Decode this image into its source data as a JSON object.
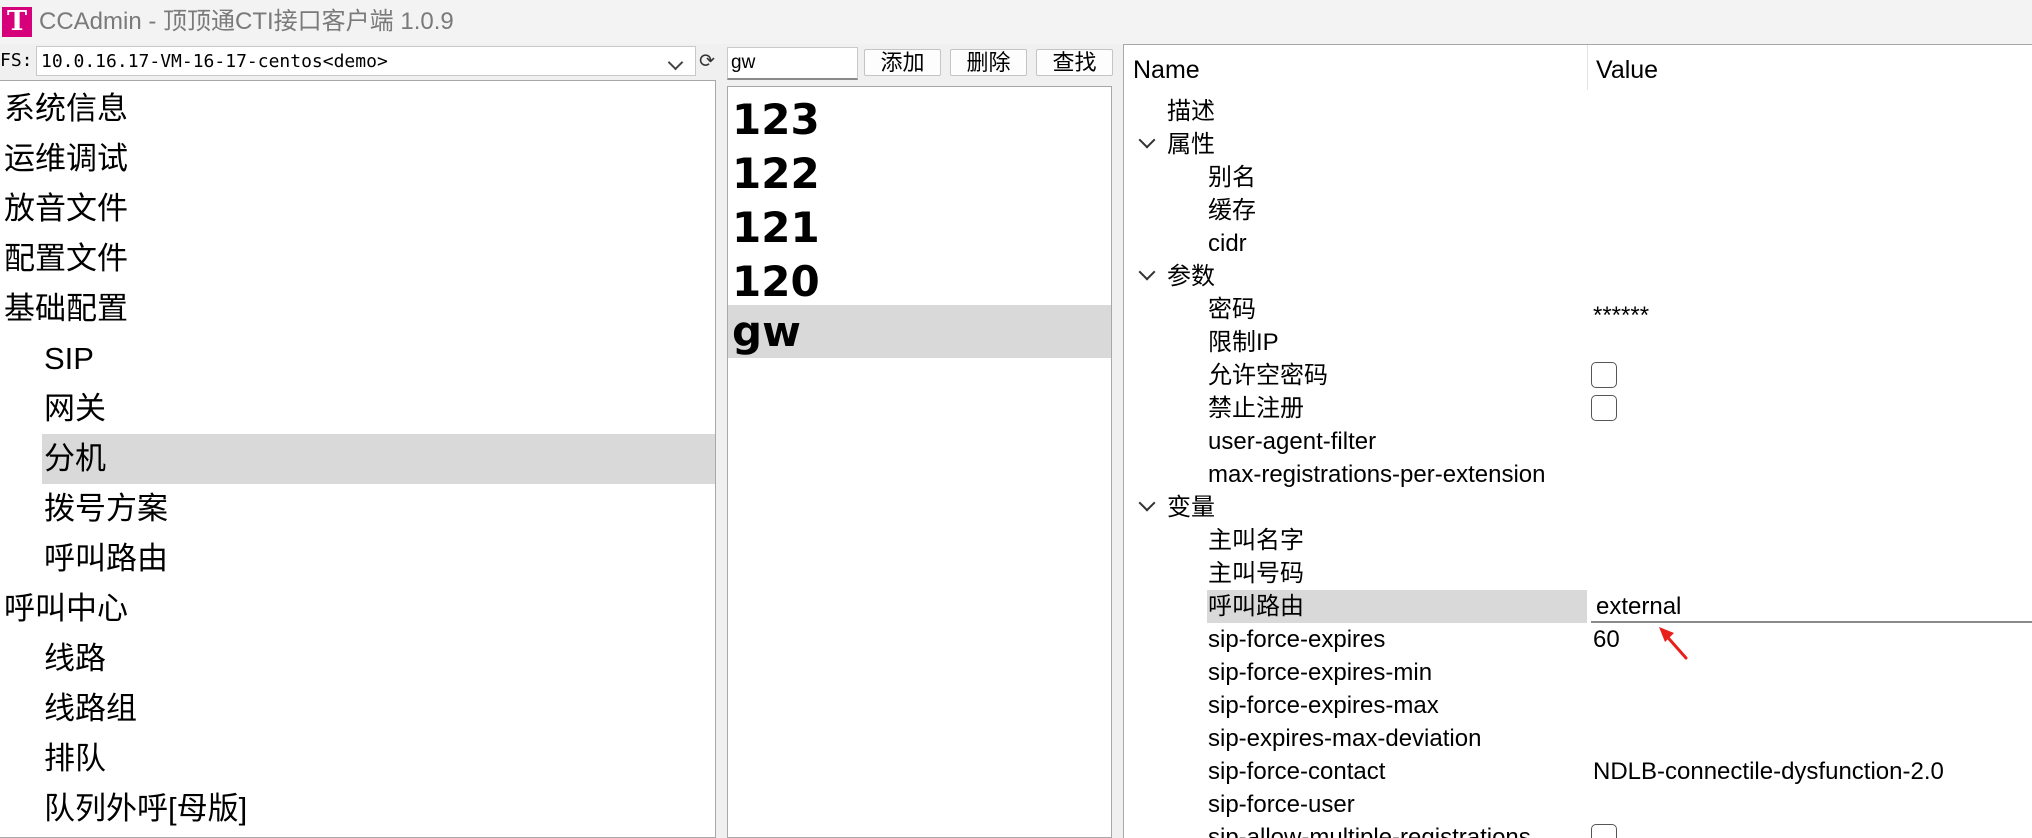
{
  "window": {
    "icon_letter": "T",
    "title": "CCAdmin - 顶顶通CTI接口客户端 1.0.9"
  },
  "fs": {
    "label": "FS:",
    "selected": "10.0.16.17-VM-16-17-centos<demo>"
  },
  "nav": {
    "items": [
      {
        "label": "系统信息"
      },
      {
        "label": "运维调试"
      },
      {
        "label": "放音文件"
      },
      {
        "label": "配置文件"
      },
      {
        "label": "基础配置"
      },
      {
        "label": "SIP"
      },
      {
        "label": "网关"
      },
      {
        "label": "分机"
      },
      {
        "label": "拨号方案"
      },
      {
        "label": "呼叫路由"
      },
      {
        "label": "呼叫中心"
      },
      {
        "label": "线路"
      },
      {
        "label": "线路组"
      },
      {
        "label": "排队"
      },
      {
        "label": "队列外呼[母版]"
      }
    ],
    "selected": "分机"
  },
  "toolbar": {
    "search_value": "gw",
    "add_label": "添加",
    "delete_label": "删除",
    "find_label": "查找"
  },
  "list": {
    "items": [
      {
        "label": "123"
      },
      {
        "label": "122"
      },
      {
        "label": "121"
      },
      {
        "label": "120"
      },
      {
        "label": "gw"
      }
    ],
    "selected": "gw"
  },
  "grid": {
    "header_name": "Name",
    "header_value": "Value",
    "rows": [
      {
        "name": "描述",
        "value": ""
      },
      {
        "name": "属性",
        "value": "",
        "group": true,
        "expanded": true
      },
      {
        "name": "别名",
        "value": ""
      },
      {
        "name": "缓存",
        "value": ""
      },
      {
        "name": "cidr",
        "value": ""
      },
      {
        "name": "参数",
        "value": "",
        "group": true,
        "expanded": true
      },
      {
        "name": "密码",
        "value": "******"
      },
      {
        "name": "限制IP",
        "value": ""
      },
      {
        "name": "允许空密码",
        "value": "",
        "checkbox": true,
        "checked": false
      },
      {
        "name": "禁止注册",
        "value": "",
        "checkbox": true,
        "checked": false
      },
      {
        "name": "user-agent-filter",
        "value": ""
      },
      {
        "name": "max-registrations-per-extension",
        "value": ""
      },
      {
        "name": "变量",
        "value": "",
        "group": true,
        "expanded": true
      },
      {
        "name": "主叫名字",
        "value": ""
      },
      {
        "name": "主叫号码",
        "value": ""
      },
      {
        "name": "呼叫路由",
        "value": "external",
        "editing": true
      },
      {
        "name": "sip-force-expires",
        "value": "60"
      },
      {
        "name": "sip-force-expires-min",
        "value": ""
      },
      {
        "name": "sip-force-expires-max",
        "value": ""
      },
      {
        "name": "sip-expires-max-deviation",
        "value": ""
      },
      {
        "name": "sip-force-contact",
        "value": "NDLB-connectile-dysfunction-2.0"
      },
      {
        "name": "sip-force-user",
        "value": ""
      },
      {
        "name": "sip-allow-multiple-registrations",
        "value": "",
        "checkbox": true,
        "checked": false
      }
    ]
  },
  "colors": {
    "accent": "#d6007a",
    "selection": "#d9d9d9",
    "annotation_arrow": "#e8201a"
  }
}
